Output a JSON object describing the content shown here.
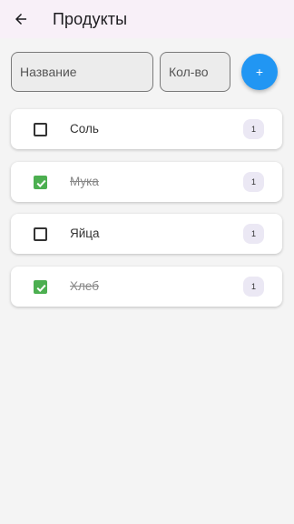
{
  "header": {
    "title": "Продукты",
    "back_icon": "arrow-left-icon"
  },
  "form": {
    "name_placeholder": "Название",
    "qty_placeholder": "Кол-во",
    "add_label": "+",
    "add_color": "#2196f3"
  },
  "items": [
    {
      "label": "Соль",
      "qty": "1",
      "checked": false
    },
    {
      "label": "Мука",
      "qty": "1",
      "checked": true
    },
    {
      "label": "Яйца",
      "qty": "1",
      "checked": false
    },
    {
      "label": "Хлеб",
      "qty": "1",
      "checked": true
    }
  ],
  "colors": {
    "checked": "#4caf50",
    "appbar": "#f8f0f8",
    "badge": "#ebe8f4"
  }
}
